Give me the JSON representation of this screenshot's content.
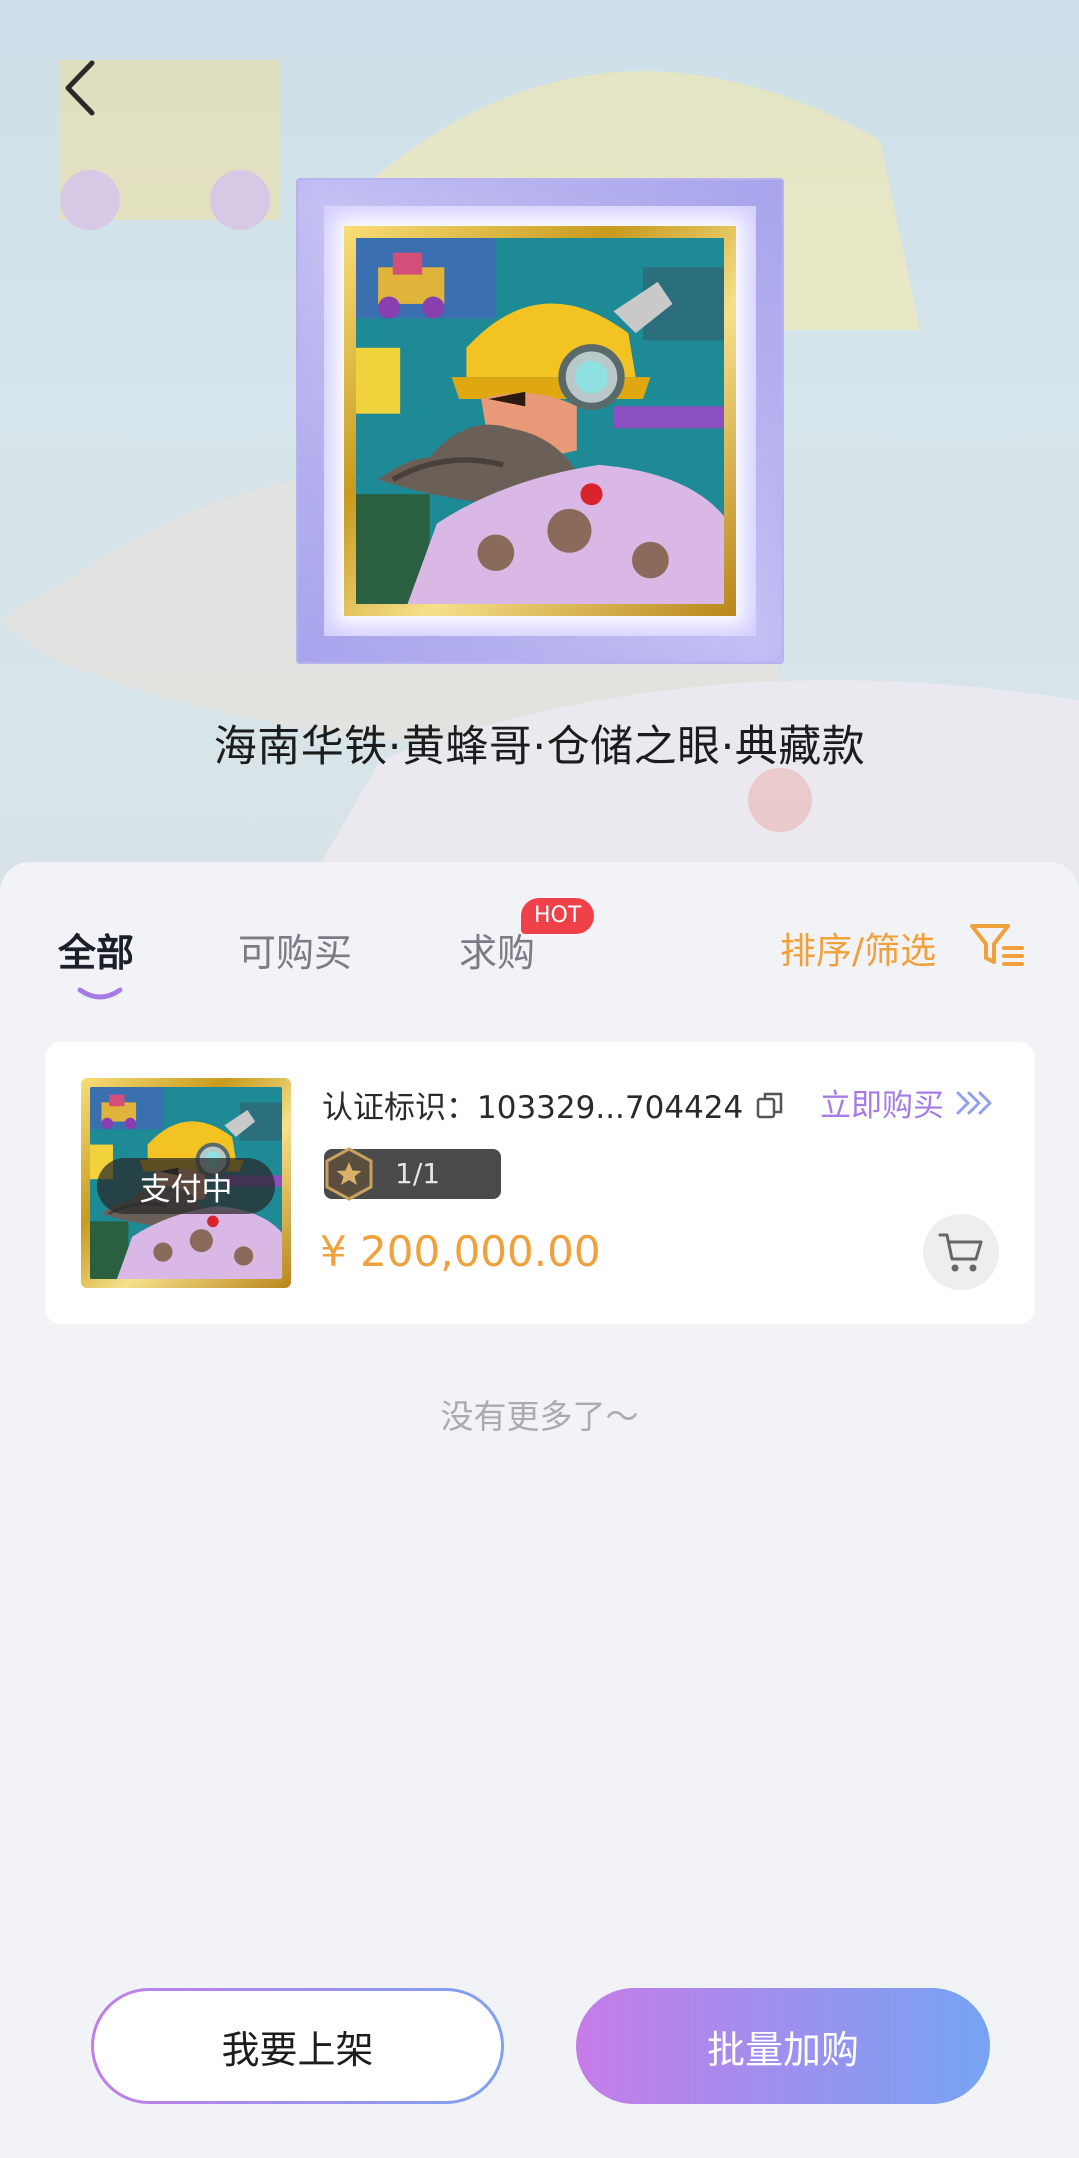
{
  "header": {
    "title": "海南华铁·黄蜂哥·仓储之眼·典藏款"
  },
  "tabs": [
    {
      "label": "全部",
      "active": true
    },
    {
      "label": "可购买",
      "active": false
    },
    {
      "label": "求购",
      "active": false,
      "badge": "HOT"
    }
  ],
  "filter": {
    "label": "排序/筛选",
    "icon": "filter-icon"
  },
  "listings": [
    {
      "status": "支付中",
      "cert_label": "认证标识：103329...704424",
      "buy_label": "立即购买",
      "edition": "1/1",
      "price": "¥ 200,000.00"
    }
  ],
  "list_end_text": "没有更多了～",
  "actions": {
    "list_label": "我要上架",
    "batch_label": "批量加购"
  },
  "colors": {
    "accent_orange": "#f0a13c",
    "accent_purple": "#a77be6",
    "hot_red": "#f0404a",
    "gradient_start": "#c67ce8",
    "gradient_end": "#76a3f3"
  }
}
